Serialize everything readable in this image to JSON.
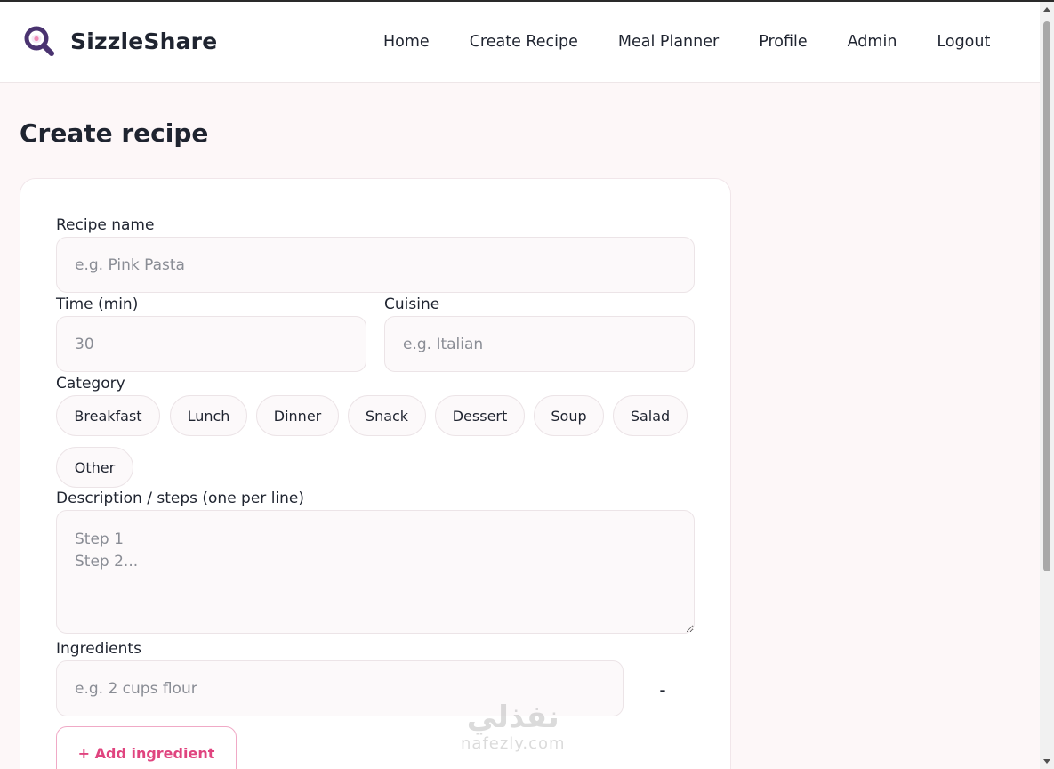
{
  "app": {
    "name": "SizzleShare",
    "accent": "#e0447f",
    "icon": "magnifier-with-egg-icon"
  },
  "nav": {
    "items": [
      {
        "label": "Home"
      },
      {
        "label": "Create Recipe"
      },
      {
        "label": "Meal Planner"
      },
      {
        "label": "Profile"
      },
      {
        "label": "Admin"
      },
      {
        "label": "Logout"
      }
    ]
  },
  "page": {
    "title": "Create recipe"
  },
  "form": {
    "recipe_name": {
      "label": "Recipe name",
      "placeholder": "e.g. Pink Pasta",
      "value": ""
    },
    "time": {
      "label": "Time (min)",
      "placeholder": "30",
      "value": ""
    },
    "cuisine": {
      "label": "Cuisine",
      "placeholder": "e.g. Italian",
      "value": ""
    },
    "category": {
      "label": "Category",
      "options": [
        "Breakfast",
        "Lunch",
        "Dinner",
        "Snack",
        "Dessert",
        "Soup",
        "Salad",
        "Other"
      ]
    },
    "description": {
      "label": "Description / steps (one per line)",
      "placeholder": "Step 1\nStep 2...",
      "value": ""
    },
    "ingredients": {
      "label": "Ingredients",
      "items": [
        {
          "placeholder": "e.g. 2 cups flour",
          "value": "",
          "remove_label": "-"
        }
      ],
      "add_label": "+ Add ingredient"
    }
  },
  "watermark": {
    "arabic": "نفذلي",
    "latin": "nafezly.com"
  }
}
